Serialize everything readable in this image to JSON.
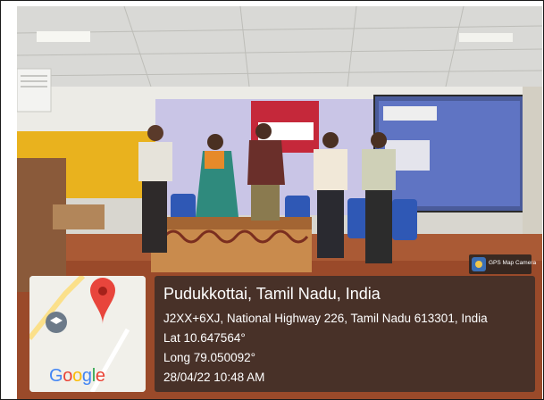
{
  "geotag": {
    "location": "Pudukkottai, Tamil Nadu, India",
    "address": "J2XX+6XJ, National Highway 226, Tamil Nadu 613301, India",
    "latitude": "Lat 10.647564°",
    "longitude": "Long 79.050092°",
    "datetime": "28/04/22 10:48 AM"
  },
  "maps_logo_text": "Google",
  "app_badge_text": "GPS Map Camera",
  "colors": {
    "panel_bg": "#282828",
    "pin_red": "#e8453c",
    "google_blue": "#4285f4",
    "google_red": "#ea4335",
    "google_yellow": "#fbbc05",
    "google_green": "#34a853"
  }
}
